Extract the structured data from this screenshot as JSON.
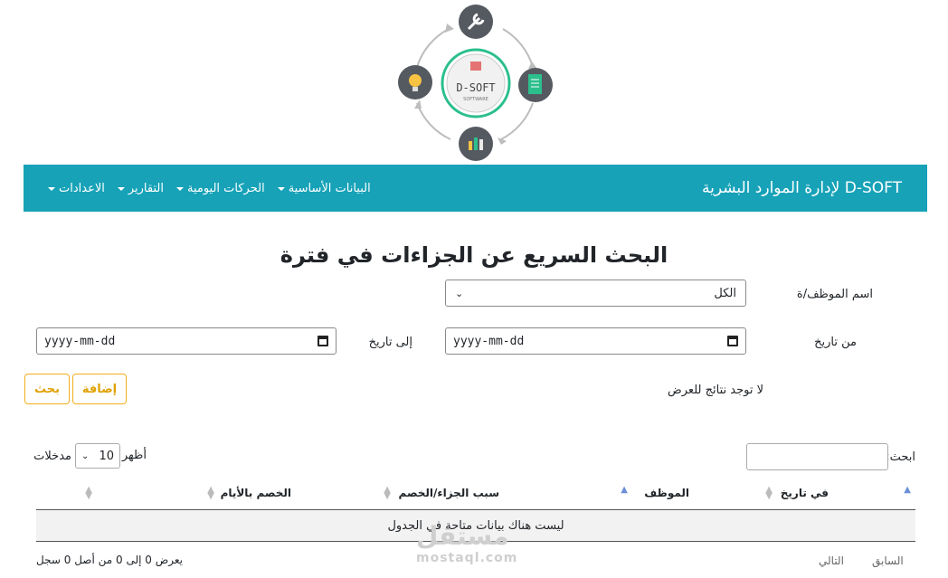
{
  "logo": {
    "name": "D-SOFT",
    "tagline": "SOFTWARE"
  },
  "navbar": {
    "brand": "D-SOFT لإدارة الموارد البشرية",
    "items": [
      {
        "label": "البيانات الأساسية"
      },
      {
        "label": "الحركات اليومية"
      },
      {
        "label": "التقارير"
      },
      {
        "label": "الاعدادات"
      }
    ]
  },
  "page": {
    "title": "البحث السريع عن الجزاءات في فترة"
  },
  "form": {
    "employee_label": "اسم الموظف/ة",
    "employee_value": "الكل",
    "from_label": "من تاريخ",
    "from_placeholder": "yyyy-mm-dd",
    "to_label": "إلى تاريخ",
    "to_placeholder": "yyyy-mm-dd",
    "search_button": "بحث",
    "add_button": "إضافة",
    "no_results": "لا توجد نتائج للعرض"
  },
  "table": {
    "search_label": "ابحث:",
    "show_label": "أظهر",
    "entries_label": "مدخلات",
    "page_length": "10",
    "columns": [
      "في تاريخ",
      "الموظف",
      "سبب الجزاء/الخصم",
      "الخصم بالأيام",
      "",
      ""
    ],
    "empty": "ليست هناك بيانات متاحة في الجدول",
    "info": "يعرض 0 إلى 0 من أصل 0 سجل",
    "previous": "السابق",
    "next": "التالي"
  },
  "watermark": {
    "latin": "mostaql.com",
    "arabic": "مستقل"
  },
  "colors": {
    "navbar": "#17a2b8",
    "button_border": "#f0ad1c",
    "accent_ring": "#2bbf8c"
  }
}
